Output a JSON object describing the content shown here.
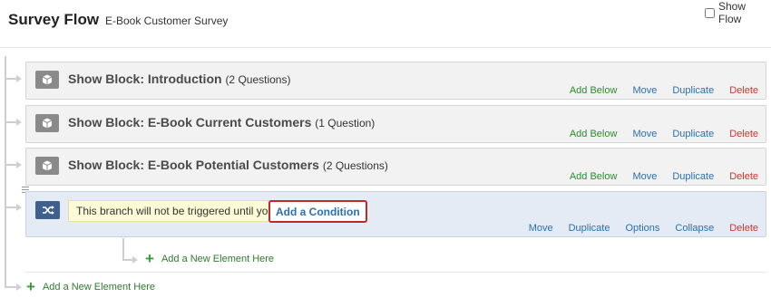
{
  "header": {
    "title": "Survey Flow",
    "subtitle": "E-Book Customer Survey",
    "show_flow_label": "Show Flow",
    "show_flow_checked": false
  },
  "blocks": [
    {
      "title": "Show Block: Introduction",
      "question_count": "(2 Questions)",
      "actions": {
        "add_below": "Add Below",
        "move": "Move",
        "duplicate": "Duplicate",
        "delete": "Delete"
      }
    },
    {
      "title": "Show Block: E-Book Current Customers",
      "question_count": "(1 Question)",
      "actions": {
        "add_below": "Add Below",
        "move": "Move",
        "duplicate": "Duplicate",
        "delete": "Delete"
      }
    },
    {
      "title": "Show Block: E-Book Potential Customers",
      "question_count": "(2 Questions)",
      "actions": {
        "add_below": "Add Below",
        "move": "Move",
        "duplicate": "Duplicate",
        "delete": "Delete"
      }
    }
  ],
  "branch": {
    "message": "This branch will not be triggered until you",
    "add_condition_label": "Add a Condition",
    "actions": {
      "move": "Move",
      "duplicate": "Duplicate",
      "options": "Options",
      "collapse": "Collapse",
      "delete": "Delete"
    },
    "add_element_label": "Add a New Element Here"
  },
  "add_element_label": "Add a New Element Here",
  "colors": {
    "add_below": "#2f8a2f",
    "link": "#2a6fb0",
    "delete": "#d0342c",
    "condition_highlight": "#c0282a",
    "branch_bg": "#e4ebf4"
  },
  "icons": {
    "block": "cube-icon",
    "branch": "shuffle-icon",
    "add": "plus-icon",
    "connector": "flow-arrow-icon"
  }
}
